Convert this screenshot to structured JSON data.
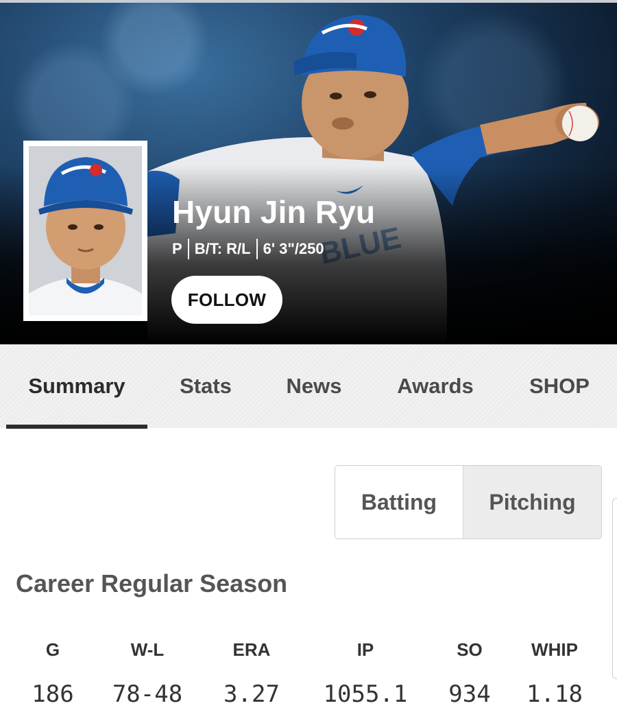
{
  "player": {
    "name": "Hyun Jin Ryu",
    "position": "P",
    "bats_throws": "B/T: R/L",
    "height_weight": "6' 3\"/250",
    "follow_label": "FOLLOW"
  },
  "tabs": [
    {
      "label": "Summary",
      "active": true
    },
    {
      "label": "Stats",
      "active": false
    },
    {
      "label": "News",
      "active": false
    },
    {
      "label": "Awards",
      "active": false
    },
    {
      "label": "SHOP",
      "active": false
    }
  ],
  "stat_toggle": {
    "batting": "Batting",
    "pitching": "Pitching",
    "selected": "Pitching"
  },
  "career": {
    "title": "Career Regular Season",
    "headers": [
      "G",
      "W-L",
      "ERA",
      "IP",
      "SO",
      "WHIP"
    ],
    "values": [
      "186",
      "78-48",
      "3.27",
      "1055.1",
      "934",
      "1.18"
    ]
  },
  "colors": {
    "jays_blue": "#1e5fb4",
    "cap_red": "#d42b2b",
    "tab_underline": "#2d2d2d"
  },
  "icons": {
    "team_logo": "blue-jays-logo",
    "uniform_brand": "swoosh"
  }
}
